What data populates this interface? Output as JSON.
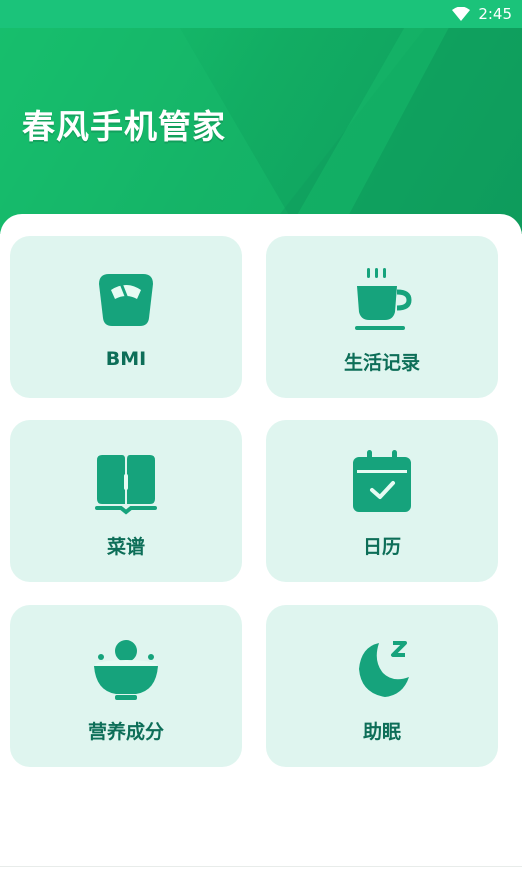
{
  "status_bar": {
    "time": "2:45",
    "wifi_icon": "wifi-icon"
  },
  "header": {
    "title": "春风手机管家"
  },
  "colors": {
    "accent": "#1bc37a",
    "icon_green": "#16a37c",
    "card_bg": "#dff5ef",
    "label_color": "#0d6e58"
  },
  "cards": [
    {
      "label": "BMI",
      "icon": "scale-icon"
    },
    {
      "label": "生活记录",
      "icon": "coffee-cup-icon"
    },
    {
      "label": "菜谱",
      "icon": "recipe-book-icon"
    },
    {
      "label": "日历",
      "icon": "calendar-check-icon"
    },
    {
      "label": "营养成分",
      "icon": "food-bowl-icon"
    },
    {
      "label": "助眠",
      "icon": "moon-sleep-icon"
    }
  ]
}
